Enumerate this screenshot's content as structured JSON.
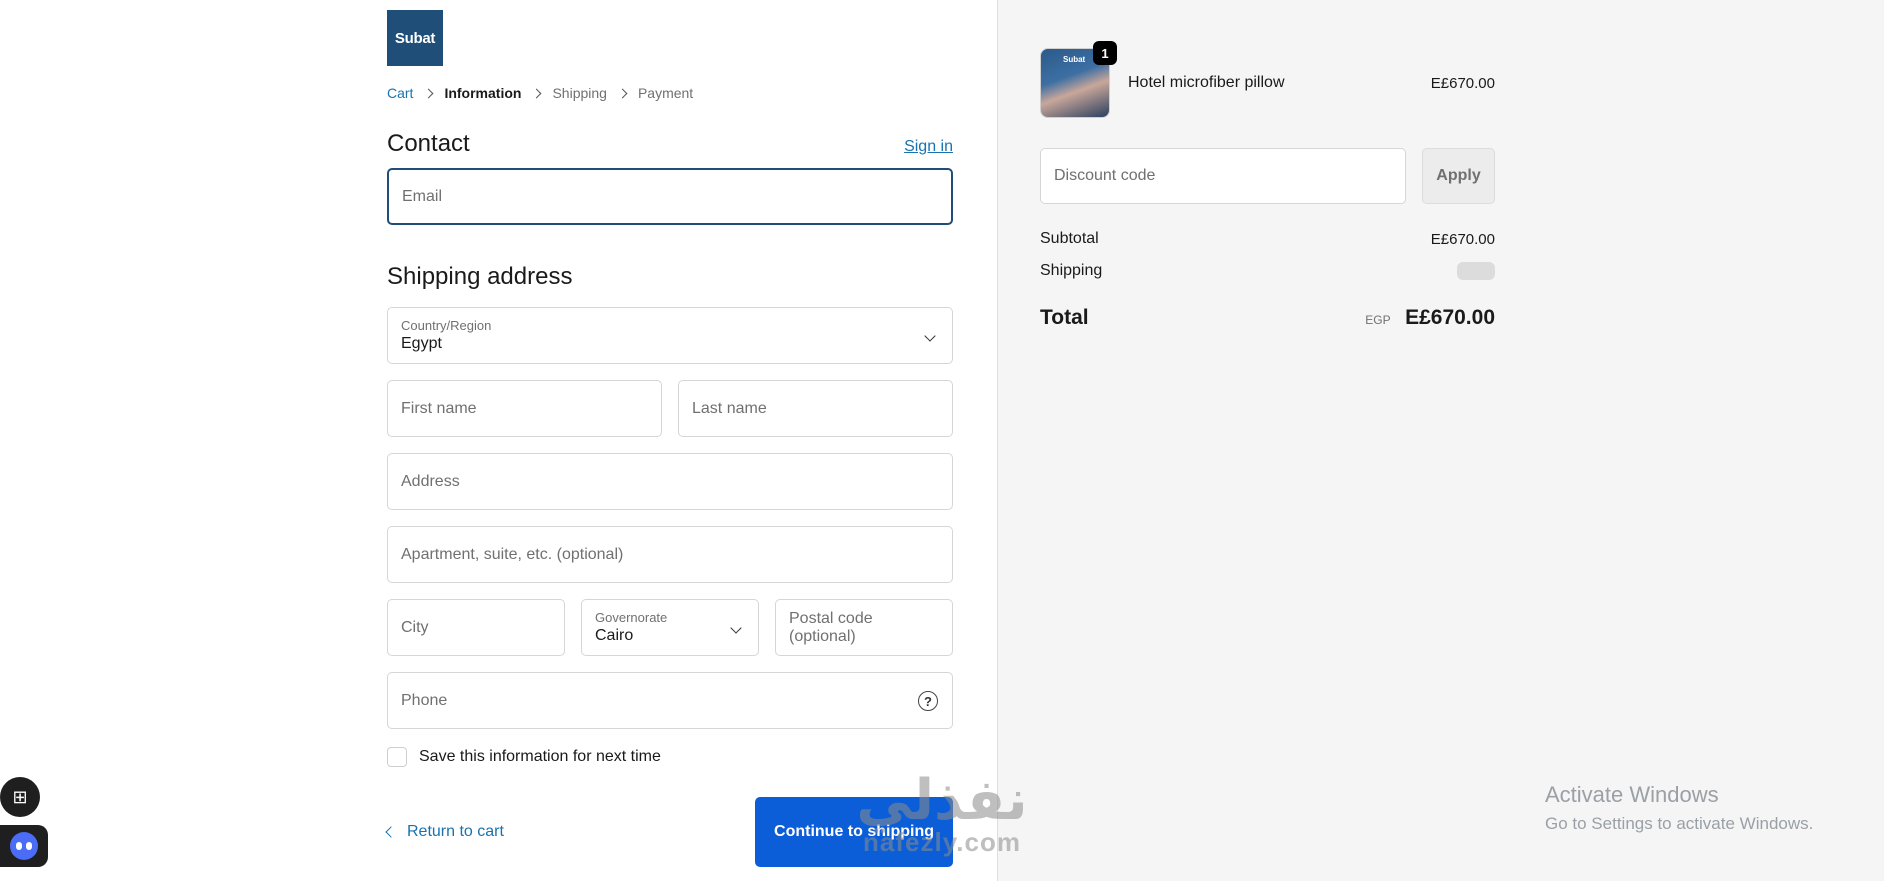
{
  "brand": {
    "logo_text": "Subat"
  },
  "breadcrumb": {
    "cart": "Cart",
    "information": "Information",
    "shipping": "Shipping",
    "payment": "Payment"
  },
  "contact": {
    "title": "Contact",
    "sign_in": "Sign in",
    "email_placeholder": "Email"
  },
  "shipping_address": {
    "title": "Shipping address",
    "country_label": "Country/Region",
    "country_value": "Egypt",
    "first_name": "First name",
    "last_name": "Last name",
    "address": "Address",
    "apartment": "Apartment, suite, etc. (optional)",
    "city": "City",
    "governorate_label": "Governorate",
    "governorate_value": "Cairo",
    "postal": "Postal code (optional)",
    "phone": "Phone",
    "help_icon": "?"
  },
  "save_info": "Save this information for next time",
  "actions": {
    "return": "Return to cart",
    "continue": "Continue to shipping"
  },
  "order": {
    "item_logo": "Subat",
    "item_name": "Hotel microfiber pillow",
    "item_qty": "1",
    "item_price": "E£670.00",
    "discount_placeholder": "Discount code",
    "apply": "Apply",
    "subtotal_label": "Subtotal",
    "subtotal_value": "E£670.00",
    "shipping_label": "Shipping",
    "total_label": "Total",
    "currency": "EGP",
    "total_value": "E£670.00"
  },
  "overlay": {
    "activate_title": "Activate Windows",
    "activate_sub": "Go to Settings to activate Windows.",
    "watermark_ar": "نفذلي",
    "watermark_lat": "nafezly.com"
  },
  "colors": {
    "accent": "#1f4e79",
    "link": "#1773b0",
    "button": "#0b5ed7"
  }
}
